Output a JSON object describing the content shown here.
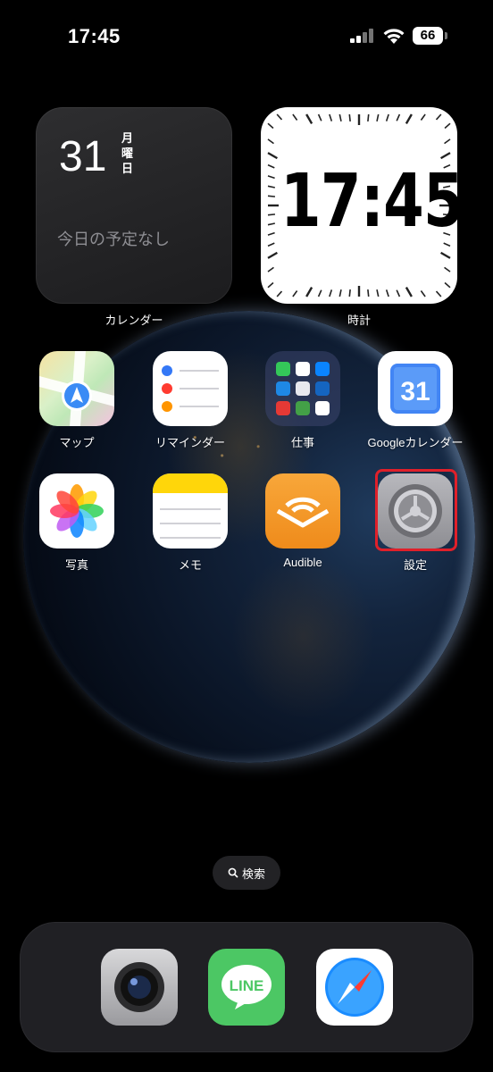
{
  "status_bar": {
    "time": "17:45",
    "battery": "66"
  },
  "widgets": {
    "calendar": {
      "day": "31",
      "weekday": "月曜日",
      "event": "今日の予定なし",
      "label": "カレンダー"
    },
    "clock": {
      "time": "17:45",
      "label": "時計"
    }
  },
  "apps": [
    {
      "label": "マップ",
      "icon": "maps-icon"
    },
    {
      "label": "リマインダー",
      "icon": "reminders-icon"
    },
    {
      "label": "仕事",
      "icon": "folder-icon"
    },
    {
      "label": "Googleカレンダー",
      "icon": "google-calendar-icon",
      "badge_text": "31"
    },
    {
      "label": "写真",
      "icon": "photos-icon"
    },
    {
      "label": "メモ",
      "icon": "notes-icon"
    },
    {
      "label": "Audible",
      "icon": "audible-icon"
    },
    {
      "label": "設定",
      "icon": "settings-icon"
    }
  ],
  "search": {
    "label": "検索"
  },
  "dock": [
    {
      "icon": "camera-icon"
    },
    {
      "icon": "line-icon",
      "text": "LINE"
    },
    {
      "icon": "safari-icon"
    }
  ],
  "colors": {
    "highlight": "#e0202a",
    "line_green": "#4cc764",
    "audible_orange": "#f39a28"
  }
}
